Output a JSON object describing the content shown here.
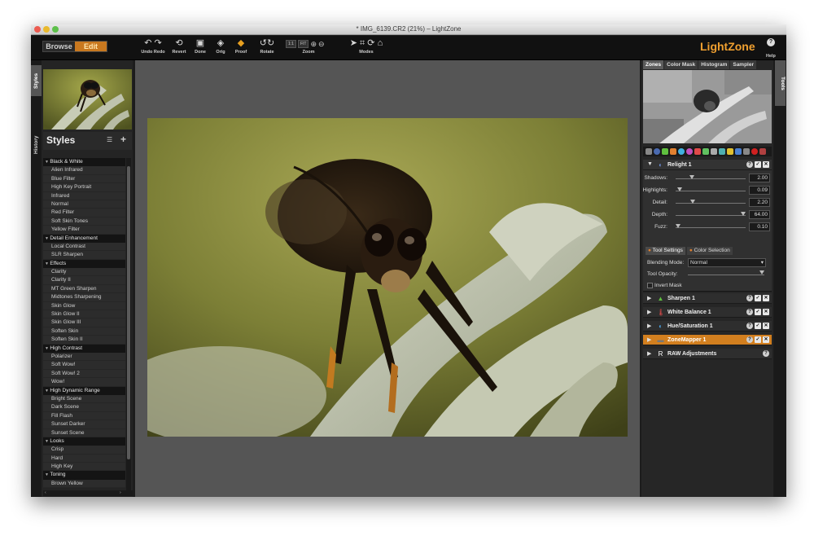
{
  "window": {
    "title": "* IMG_6139.CR2 (21%) – LightZone"
  },
  "mode": {
    "browse": "Browse",
    "edit": "Edit"
  },
  "toolbar": {
    "undo_redo": "Undo Redo",
    "revert": "Revert",
    "done": "Done",
    "orig": "Orig",
    "proof": "Proof",
    "rotate": "Rotate",
    "zoom": "Zoom",
    "zoom_1to1": "1:1",
    "zoom_fit": "FIT",
    "modes": "Modes"
  },
  "brand": "LightZone",
  "help": "Help",
  "left_tabs": {
    "styles": "Styles",
    "history": "History"
  },
  "styles": {
    "title": "Styles",
    "items": [
      {
        "type": "cat",
        "label": "Black & White"
      },
      {
        "type": "item",
        "label": "Alien Infrared"
      },
      {
        "type": "item",
        "label": "Blue Filter"
      },
      {
        "type": "item",
        "label": "High Key Portrait"
      },
      {
        "type": "item",
        "label": "Infrared"
      },
      {
        "type": "item",
        "label": "Normal"
      },
      {
        "type": "item",
        "label": "Red Filter"
      },
      {
        "type": "item",
        "label": "Soft Skin Tones"
      },
      {
        "type": "item",
        "label": "Yellow Filter"
      },
      {
        "type": "cat",
        "label": "Detail Enhancement"
      },
      {
        "type": "item",
        "label": "Local Contrast"
      },
      {
        "type": "item",
        "label": "SLR Sharpen"
      },
      {
        "type": "cat",
        "label": "Effects"
      },
      {
        "type": "item",
        "label": "Clarity"
      },
      {
        "type": "item",
        "label": "Clarity II"
      },
      {
        "type": "item",
        "label": "MT Green Sharpen"
      },
      {
        "type": "item",
        "label": "Midtones Sharpening"
      },
      {
        "type": "item",
        "label": "Skin Glow"
      },
      {
        "type": "item",
        "label": "Skin Glow II"
      },
      {
        "type": "item",
        "label": "Skin Glow III"
      },
      {
        "type": "item",
        "label": "Soften Skin"
      },
      {
        "type": "item",
        "label": "Soften Skin II"
      },
      {
        "type": "cat",
        "label": "High Contrast"
      },
      {
        "type": "item",
        "label": "Polarizer"
      },
      {
        "type": "item",
        "label": "Soft Wow!"
      },
      {
        "type": "item",
        "label": "Soft Wow! 2"
      },
      {
        "type": "item",
        "label": "Wow!"
      },
      {
        "type": "cat",
        "label": "High Dynamic Range"
      },
      {
        "type": "item",
        "label": "Bright Scene"
      },
      {
        "type": "item",
        "label": "Dark Scene"
      },
      {
        "type": "item",
        "label": "Fill Flash"
      },
      {
        "type": "item",
        "label": "Sunset Darker"
      },
      {
        "type": "item",
        "label": "Sunset Scene"
      },
      {
        "type": "cat",
        "label": "Looks"
      },
      {
        "type": "item",
        "label": "Crisp"
      },
      {
        "type": "item",
        "label": "Hard"
      },
      {
        "type": "item",
        "label": "High Key"
      },
      {
        "type": "cat",
        "label": "Toning"
      },
      {
        "type": "item",
        "label": "Brown Yellow"
      }
    ]
  },
  "right_tabs": {
    "zones": "Zones",
    "color_mask": "Color Mask",
    "histogram": "Histogram",
    "sampler": "Sampler",
    "tools": "Tools"
  },
  "relight": {
    "name": "Relight 1",
    "sliders": [
      {
        "label": "Shadows:",
        "value": "2.00",
        "pos": 0.21
      },
      {
        "label": "Highlights:",
        "value": "0.09",
        "pos": 0.03
      },
      {
        "label": "Detail:",
        "value": "2.20",
        "pos": 0.22
      },
      {
        "label": "Depth:",
        "value": "64.00",
        "pos": 0.97
      },
      {
        "label": "Fuzz:",
        "value": "0.10",
        "pos": 0.0
      }
    ],
    "tab_tool_settings": "Tool Settings",
    "tab_color_selection": "Color Selection",
    "blending_mode_label": "Blending Mode:",
    "blending_mode_value": "Normal",
    "tool_opacity_label": "Tool Opacity:",
    "invert_mask_label": "Invert Mask"
  },
  "tools": [
    {
      "name": "Sharpen 1",
      "icon": "▲",
      "color": "#5fbf3f"
    },
    {
      "name": "White Balance 1",
      "icon": "🌡",
      "color": "#e04a4a"
    },
    {
      "name": "Hue/Saturation 1",
      "icon": "◐",
      "color": "#4aa0e0"
    },
    {
      "name": "ZoneMapper 1",
      "icon": "▬",
      "color": "#777",
      "active": true
    },
    {
      "name": "RAW Adjustments",
      "icon": "R",
      "color": "#fff"
    }
  ]
}
